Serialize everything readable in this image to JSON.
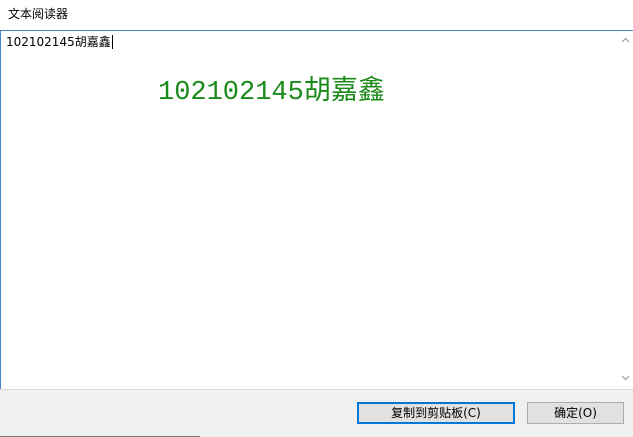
{
  "window": {
    "title": "文本阅读器"
  },
  "editor": {
    "content": "102102145胡嘉鑫"
  },
  "overlay": {
    "text": "102102145胡嘉鑫",
    "color": "#1a8a1a"
  },
  "buttons": {
    "copy_label": "复制到剪贴板(C)",
    "ok_label": "确定(O)"
  },
  "colors": {
    "accent": "#0078d7",
    "text_area_border": "#4a86c8",
    "footer_bg": "#f0f0f0"
  }
}
